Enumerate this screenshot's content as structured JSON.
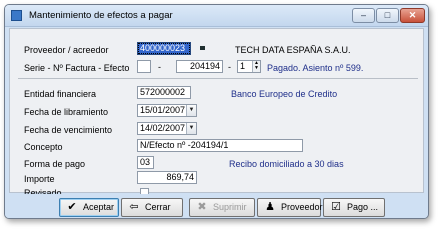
{
  "window": {
    "title": "Mantenimiento de efectos a pagar",
    "controls": {
      "minimize": "–",
      "maximize": "□",
      "close": "✕"
    }
  },
  "form": {
    "proveedor": {
      "label": "Proveedor / acreedor",
      "value": "400000023",
      "name": "TECH DATA ESPAÑA S.A.U."
    },
    "factura": {
      "label": "Serie - Nº Factura - Efecto",
      "serie": "",
      "dash1": "-",
      "numero": "204194",
      "dash2": "-",
      "efecto": "1",
      "status": "Pagado. Asiento nº 599."
    },
    "entidad": {
      "label": "Entidad financiera",
      "value": "572000002",
      "name": "Banco Europeo de Credito"
    },
    "fecha_libramiento": {
      "label": "Fecha de libramiento",
      "value": "15/01/2007"
    },
    "fecha_vencimiento": {
      "label": "Fecha de vencimiento",
      "value": "14/02/2007"
    },
    "concepto": {
      "label": "Concepto",
      "value": "N/Efecto nº -204194/1"
    },
    "forma_pago": {
      "label": "Forma de pago",
      "value": "03",
      "description": "Recibo domiciliado a 30 dias"
    },
    "importe": {
      "label": "Importe",
      "value": "869,74"
    },
    "revisado": {
      "label": "Revisado",
      "checked": false
    }
  },
  "buttons": {
    "aceptar": "Aceptar",
    "cerrar": "Cerrar",
    "suprimir": "Suprimir",
    "proveedor": "Proveedor",
    "pago": "Pago ..."
  },
  "icons": {
    "aceptar": "checkmark-icon",
    "cerrar": "exit-door-icon",
    "suprimir": "delete-x-icon",
    "proveedor": "person-icon",
    "pago": "payment-check-icon"
  }
}
